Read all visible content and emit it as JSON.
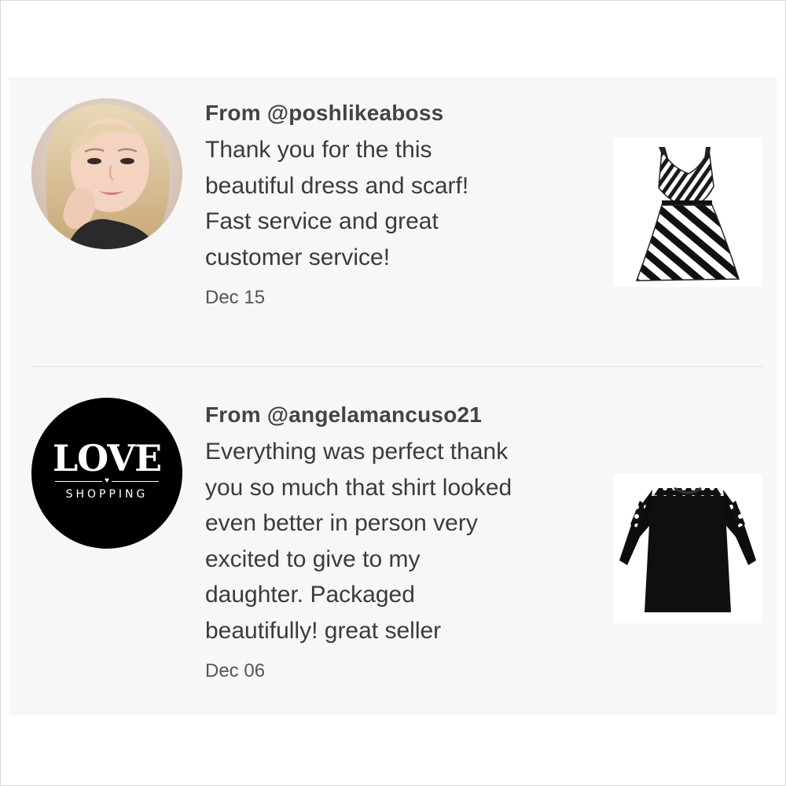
{
  "reviews": [
    {
      "from": "From @poshlikeaboss",
      "message": "Thank you for the this\nbeautiful dress and scarf!\nFast service and great\ncustomer service!",
      "date": "Dec 15",
      "avatar_icon": "user-photo-avatar",
      "product_icon": "striped-dress-thumbnail"
    },
    {
      "from": "From @angelamancuso21",
      "message": "Everything was perfect thank\nyou so much that shirt looked\neven better in person very\nexcited to give to my\ndaughter. Packaged\nbeautifully! great seller",
      "date": "Dec 06",
      "avatar_logo": {
        "top": "LOVE",
        "bottom": "SHOPPING"
      },
      "product_icon": "black-lace-shirt-thumbnail"
    }
  ],
  "colors": {
    "background": "#ffffff",
    "panel": "#f7f7f7",
    "text": "#3b3b3b",
    "divider": "#e2e2e2"
  }
}
